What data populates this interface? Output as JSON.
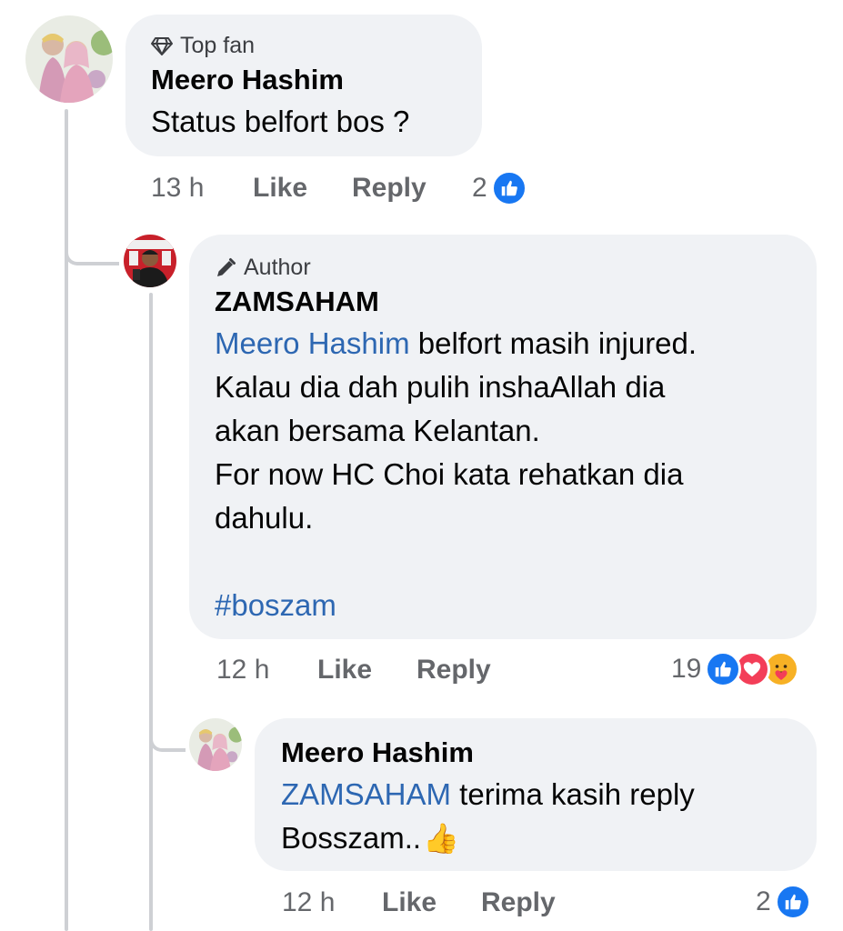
{
  "comment": {
    "badge_label": "Top fan",
    "badge_icon": "diamond-icon",
    "author": "Meero Hashim",
    "text": "Status belfort bos ?",
    "time": "13 h",
    "like_label": "Like",
    "reply_label": "Reply",
    "reaction_count": "2",
    "reactions": [
      "like"
    ]
  },
  "reply1": {
    "badge_label": "Author",
    "badge_icon": "pencil-icon",
    "author": "ZAMSAHAM",
    "mention": "Meero Hashim",
    "line1": " belfort masih injured.",
    "line2": "Kalau dia dah pulih inshaAllah dia",
    "line3": "akan bersama Kelantan.",
    "line4": "For now HC Choi kata rehatkan dia",
    "line5": "dahulu.",
    "hashtag": "#boszam",
    "time": "12 h",
    "like_label": "Like",
    "reply_label": "Reply",
    "reaction_count": "19",
    "reactions": [
      "like",
      "love",
      "care"
    ]
  },
  "reply2": {
    "author": "Meero Hashim",
    "mention": "ZAMSAHAM",
    "line1": " terima kasih reply",
    "line2": "Bosszam..",
    "emoji": "👍",
    "time": "12 h",
    "like_label": "Like",
    "reply_label": "Reply",
    "reaction_count": "2",
    "reactions": [
      "like"
    ]
  },
  "colors": {
    "bubble": "#f0f2f5",
    "link": "#2d67b2",
    "meta": "#65676b",
    "like": "#1877f2",
    "love": "#f33e58",
    "care": "#f7b125",
    "connector": "#ced0d4"
  }
}
